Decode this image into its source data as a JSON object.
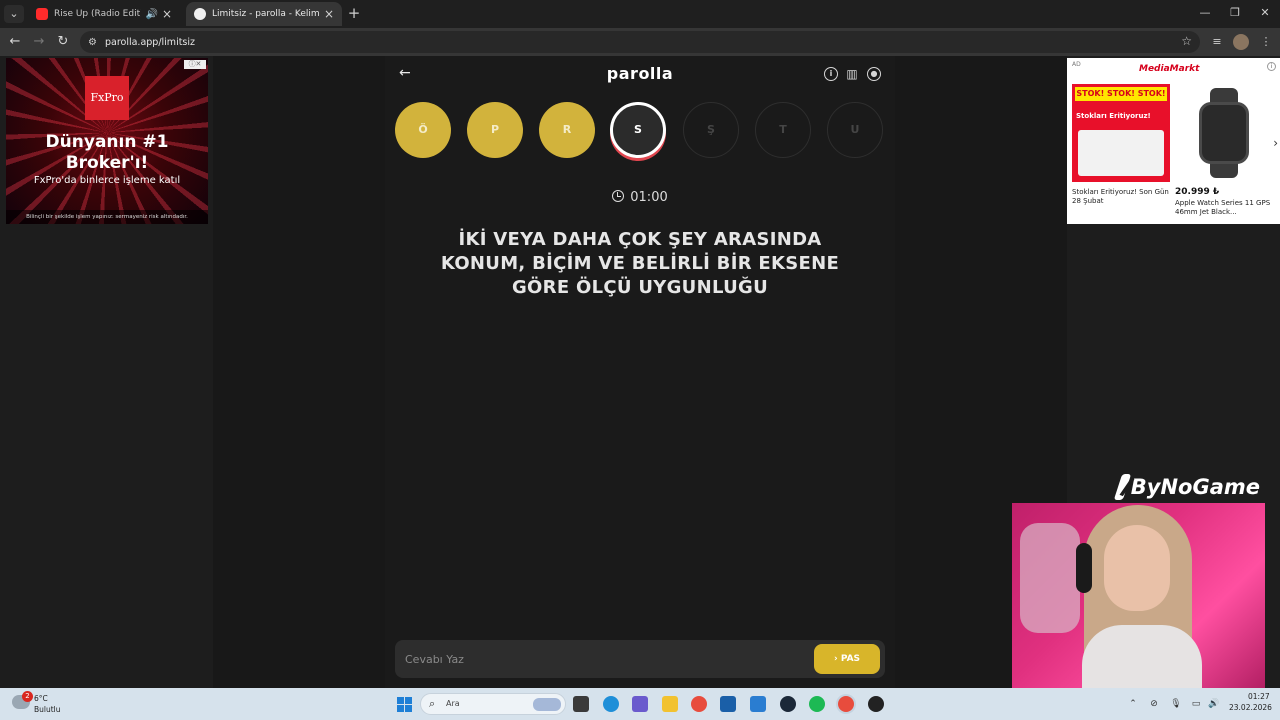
{
  "browser": {
    "tabs": [
      {
        "title": "Rise Up (Radio Edit) - YouTube",
        "active": false,
        "favicon_color": "#ff2b2b"
      },
      {
        "title": "Limitsiz - parolla - Kelime oyunu",
        "active": true,
        "favicon_color": "#f0f0f0"
      }
    ],
    "url": "parolla.app/limitsiz"
  },
  "ads": {
    "left": {
      "logo": "FxPro",
      "headline": "Dünyanın #1 Broker'ı!",
      "subline": "FxPro'da binlerce işleme katıl",
      "disclaimer": "Bilinçli bir şekilde işlem yapınız: sermayeniz risk altındadır."
    },
    "right": {
      "ad_label": "AD",
      "brand": "MediaMarkt",
      "promo_title": "STOK! STOK! STOK!",
      "promo_sub": "Stokları Eritiyoruz!",
      "caption1": "Stokları Eritiyoruz! Son Gün 28 Şubat",
      "price": "20.999 ₺",
      "caption2": "Apple Watch Series 11 GPS 46mm Jet Black..."
    }
  },
  "game": {
    "logo": "parolla",
    "letters": [
      {
        "char": "Ö",
        "state": "done"
      },
      {
        "char": "P",
        "state": "done"
      },
      {
        "char": "R",
        "state": "done"
      },
      {
        "char": "S",
        "state": "current"
      },
      {
        "char": "Ş",
        "state": "pending"
      },
      {
        "char": "T",
        "state": "pending"
      },
      {
        "char": "U",
        "state": "pending"
      }
    ],
    "timer": "01:00",
    "question": "İKİ VEYA DAHA ÇOK ŞEY ARASINDA KONUM, BİÇİM VE BELİRLİ BİR EKSENE GÖRE ÖLÇÜ UYGUNLUĞU",
    "answer_placeholder": "Cevabı Yaz",
    "pass_label": "PAS"
  },
  "overlay": {
    "sponsor": "ByNoGame"
  },
  "taskbar": {
    "weather_temp": "6°C",
    "weather_cond": "Bulutlu",
    "weather_badge": "2",
    "search_placeholder": "Ara",
    "time": "01:27",
    "date": "23.02.2026"
  }
}
